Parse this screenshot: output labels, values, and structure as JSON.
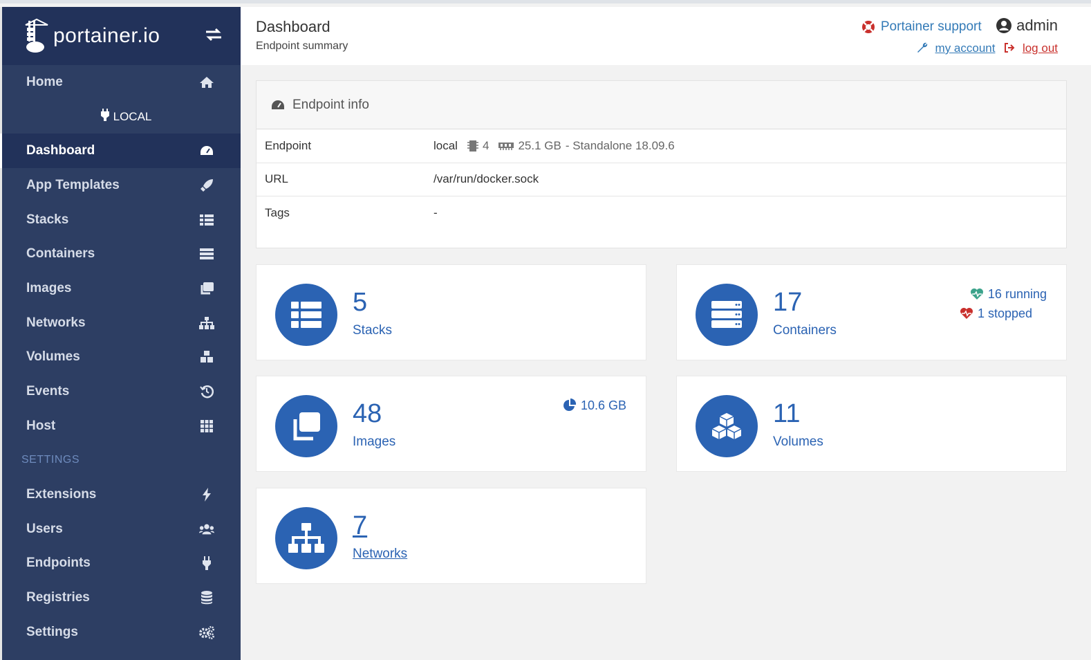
{
  "brand": {
    "logo_text": "portainer.io"
  },
  "sidebar": {
    "home_label": "Home",
    "endpoint_label": "LOCAL",
    "items": [
      {
        "label": "Dashboard",
        "icon": "tachometer-icon"
      },
      {
        "label": "App Templates",
        "icon": "rocket-icon"
      },
      {
        "label": "Stacks",
        "icon": "th-list-icon"
      },
      {
        "label": "Containers",
        "icon": "server-icon"
      },
      {
        "label": "Images",
        "icon": "clone-icon"
      },
      {
        "label": "Networks",
        "icon": "sitemap-icon"
      },
      {
        "label": "Volumes",
        "icon": "cubes-icon"
      },
      {
        "label": "Events",
        "icon": "history-icon"
      },
      {
        "label": "Host",
        "icon": "th-icon"
      }
    ],
    "settings_section": "SETTINGS",
    "settings_items": [
      {
        "label": "Extensions",
        "icon": "bolt-icon"
      },
      {
        "label": "Users",
        "icon": "users-icon"
      },
      {
        "label": "Endpoints",
        "icon": "plug-icon"
      },
      {
        "label": "Registries",
        "icon": "database-icon"
      },
      {
        "label": "Settings",
        "icon": "cogs-icon"
      }
    ]
  },
  "header": {
    "title": "Dashboard",
    "subtitle": "Endpoint summary",
    "support": "Portainer support",
    "user": "admin",
    "my_account": "my account",
    "log_out": "log out"
  },
  "endpoint_info": {
    "title": "Endpoint info",
    "rows": {
      "endpoint": {
        "key": "Endpoint",
        "name": "local",
        "cpu": "4",
        "memory": "25.1 GB",
        "mode": "- Standalone 18.09.6"
      },
      "url": {
        "key": "URL",
        "value": "/var/run/docker.sock"
      },
      "tags": {
        "key": "Tags",
        "value": "-"
      }
    }
  },
  "widgets": {
    "stacks": {
      "count": "5",
      "label": "Stacks"
    },
    "containers": {
      "count": "17",
      "label": "Containers",
      "running": "16 running",
      "stopped": "1 stopped"
    },
    "images": {
      "count": "48",
      "label": "Images",
      "size": "10.6 GB"
    },
    "volumes": {
      "count": "11",
      "label": "Volumes"
    },
    "networks": {
      "count": "7",
      "label": "Networks"
    }
  },
  "colors": {
    "sidebar": "#2d3e63",
    "sidebar_dark": "#22325a",
    "accent": "#2b63b3",
    "running": "#3ca38b",
    "stopped": "#c9302c"
  }
}
